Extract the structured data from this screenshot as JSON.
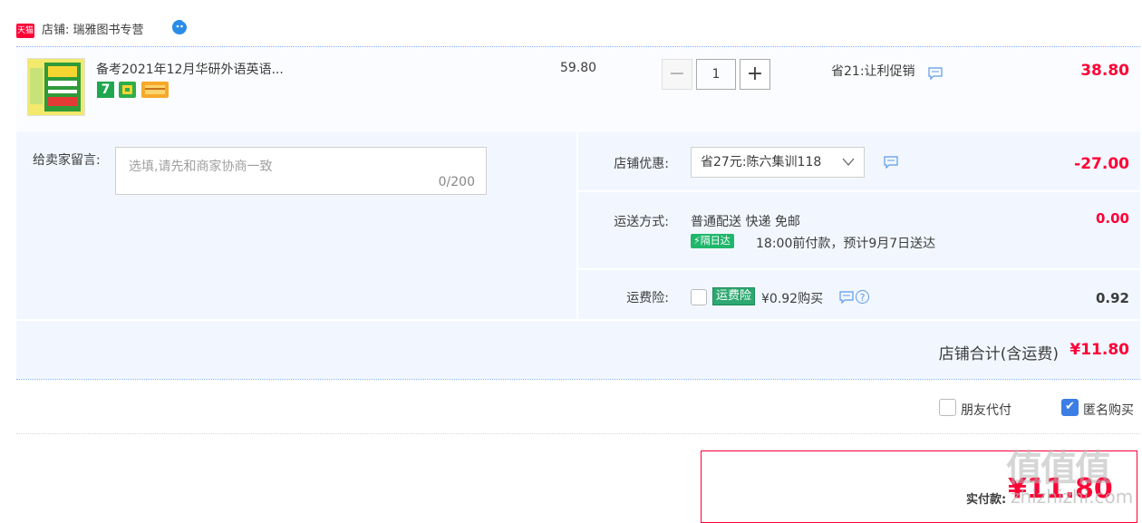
{
  "shop": {
    "badge": "天猫",
    "name": "店铺: 瑞雅图书专营"
  },
  "item": {
    "title": "备考2021年12月华研外语英语...",
    "tag_seven": "7",
    "price": "59.80",
    "quantity": "1",
    "minus": "−",
    "plus": "+",
    "promo": "省21:让利促销",
    "total": "38.80"
  },
  "message": {
    "label": "给卖家留言:",
    "placeholder": "选填,请先和商家协商一致",
    "count": "0/200"
  },
  "coupon": {
    "label": "店铺优惠:",
    "selected": "省27元:陈六集训118",
    "amount": "-27.00"
  },
  "shipping": {
    "label": "运送方式:",
    "method": "普通配送 快递 免邮",
    "badge": "隔日达",
    "eta": "18:00前付款，预计9月7日送达",
    "amount": "0.00"
  },
  "insurance": {
    "label": "运费险:",
    "badge": "运费险",
    "price_text": "¥0.92购买",
    "amount": "0.92"
  },
  "shop_total": {
    "label": "店铺合计(含运费)",
    "value": "¥11.80"
  },
  "options": {
    "friend_pay": "朋友代付",
    "anonymous": "匿名购买"
  },
  "payment": {
    "label": "实付款:",
    "value": "¥11.80"
  },
  "watermark": {
    "logo": "值值值",
    "site": "zhizhizhi.com"
  },
  "colors": {
    "accent_red": "#ff0036",
    "row_bg": "#f2f7ff",
    "check_blue": "#3d7ee5"
  }
}
